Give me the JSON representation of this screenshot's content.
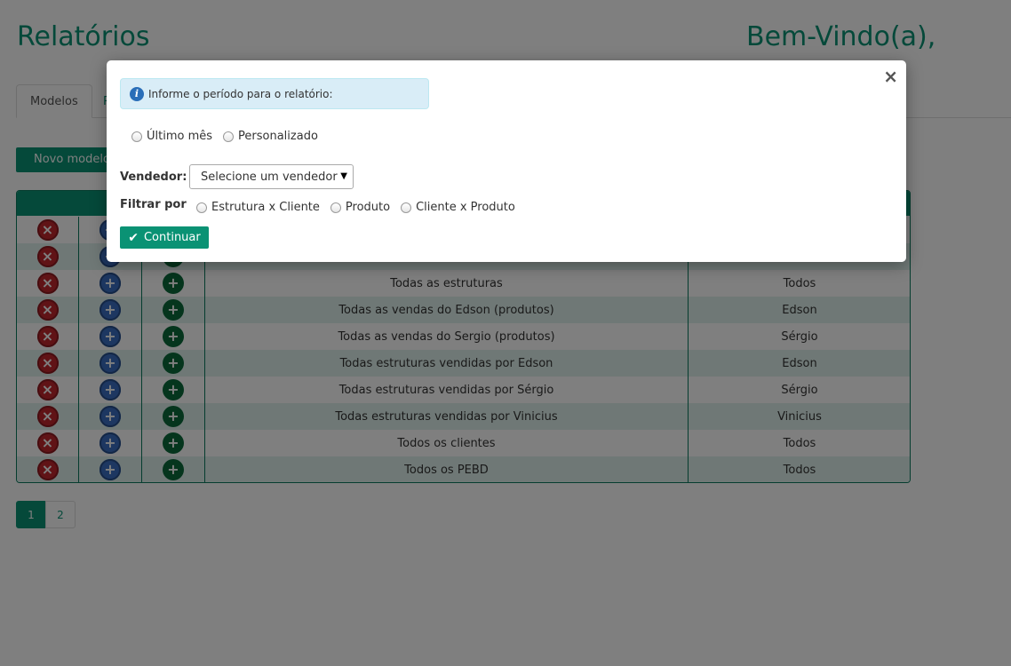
{
  "header": {
    "title": "Relatórios",
    "welcome": "Bem-Vindo(a),"
  },
  "tabs": [
    {
      "label": "Modelos"
    },
    {
      "label": "R"
    }
  ],
  "toolbar": {
    "new_model_label": "Novo modelo"
  },
  "table": {
    "rows": [
      {
        "description": "",
        "seller": ""
      },
      {
        "description": "",
        "seller": ""
      },
      {
        "description": "Todas as estruturas",
        "seller": "Todos"
      },
      {
        "description": "Todas as vendas do Edson (produtos)",
        "seller": "Edson"
      },
      {
        "description": "Todas as vendas do Sergio (produtos)",
        "seller": "Sérgio"
      },
      {
        "description": "Todas estruturas vendidas por Edson",
        "seller": "Edson"
      },
      {
        "description": "Todas estruturas vendidas por Sérgio",
        "seller": "Sérgio"
      },
      {
        "description": "Todas estruturas vendidas por Vinicius",
        "seller": "Vinicius"
      },
      {
        "description": "Todos os clientes",
        "seller": "Todos"
      },
      {
        "description": "Todos os PEBD",
        "seller": "Todos"
      }
    ]
  },
  "pagination": {
    "pages": [
      "1",
      "2"
    ],
    "active": "1"
  },
  "modal": {
    "close_glyph": "×",
    "info_icon": "i",
    "info_text": "Informe o período para o relatório:",
    "period_options": [
      "Último mês",
      "Personalizado"
    ],
    "seller_label": "Vendedor:",
    "seller_select_value": "Selecione um vendedor",
    "filter_label": "Filtrar por",
    "filter_options": [
      "Estrutura x Cliente",
      "Produto",
      "Cliente x Produto"
    ],
    "continue_label": "Continuar"
  },
  "icons": {
    "delete": "x-circle-icon",
    "edit": "plus-circle-icon",
    "add": "plus-circle-icon",
    "continue": "check-icon",
    "info": "info-icon"
  },
  "colors": {
    "accent": "#0a9274",
    "delete": "#c0272d",
    "edit": "#3b6fc2",
    "add": "#0b6b3a",
    "info_bg": "#d9edf7",
    "row_alt": "#dff1ec"
  }
}
